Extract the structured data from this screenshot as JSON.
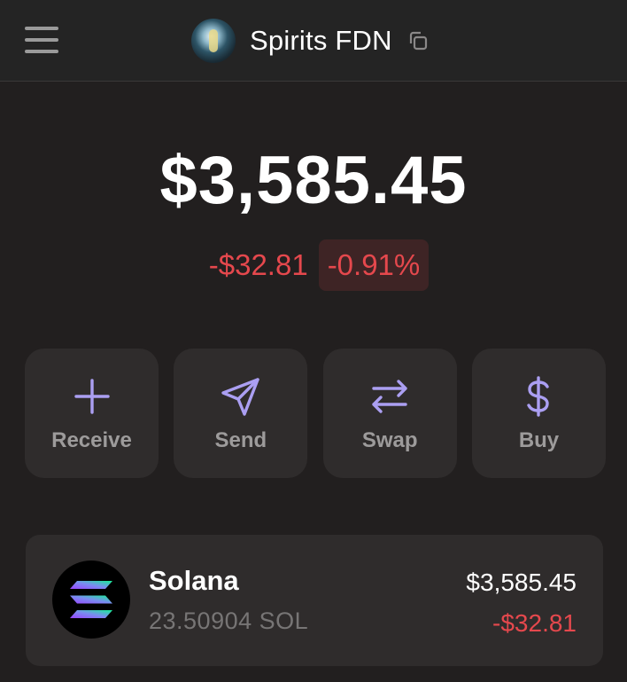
{
  "header": {
    "account_name": "Spirits FDN",
    "menu_icon": "hamburger-menu-icon",
    "copy_icon": "copy-icon"
  },
  "portfolio": {
    "balance": "$3,585.45",
    "change_amount": "-$32.81",
    "change_percent": "-0.91%"
  },
  "actions": [
    {
      "label": "Receive",
      "icon": "plus-icon"
    },
    {
      "label": "Send",
      "icon": "send-icon"
    },
    {
      "label": "Swap",
      "icon": "swap-icon"
    },
    {
      "label": "Buy",
      "icon": "dollar-icon"
    }
  ],
  "tokens": [
    {
      "name": "Solana",
      "balance": "23.50904 SOL",
      "value": "$3,585.45",
      "change": "-$32.81",
      "icon": "solana-logo-icon"
    }
  ],
  "colors": {
    "background": "#221f1f",
    "header_bg": "#242424",
    "card_bg": "#2f2c2c",
    "accent_purple": "#ab9ff2",
    "negative_red": "#e5484d",
    "muted_text": "#9d9b9b"
  }
}
